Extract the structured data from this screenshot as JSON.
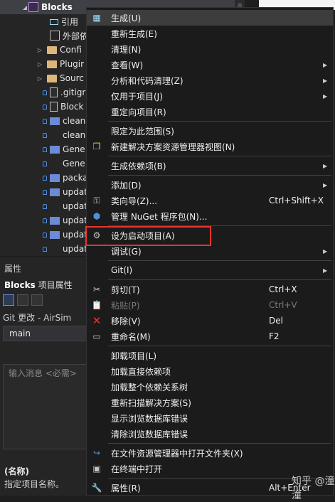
{
  "explorer": {
    "project": "Blocks",
    "items": [
      {
        "label": "引用"
      },
      {
        "label": "外部依"
      },
      {
        "label": "Confi"
      },
      {
        "label": "Plugir"
      },
      {
        "label": "Sourc"
      },
      {
        "label": ".gitigr"
      },
      {
        "label": "Block"
      },
      {
        "label": "clean"
      },
      {
        "label": "clean"
      },
      {
        "label": "Gene"
      },
      {
        "label": "Gene"
      },
      {
        "label": "packa"
      },
      {
        "label": "updat"
      },
      {
        "label": "updat"
      },
      {
        "label": "updat"
      },
      {
        "label": "updat"
      },
      {
        "label": "updat"
      }
    ]
  },
  "properties": {
    "header": "属性",
    "object_name": "Blocks",
    "object_type": "项目属性",
    "git_title": "Git 更改 - AirSim",
    "branch": "main",
    "commit_placeholder": "输入消息 <必需>",
    "name_label": "(名称)",
    "name_desc": "指定项目名称。"
  },
  "menu": {
    "items": [
      {
        "label": "生成(U)",
        "icon": "build-icon"
      },
      {
        "label": "重新生成(E)"
      },
      {
        "label": "清理(N)"
      },
      {
        "label": "查看(W)",
        "submenu": true
      },
      {
        "label": "分析和代码清理(Z)",
        "submenu": true
      },
      {
        "label": "仅用于项目(J)",
        "submenu": true
      },
      {
        "label": "重定向项目(R)"
      },
      {
        "label": "限定为此范围(S)"
      },
      {
        "label": "新建解决方案资源管理器视图(N)",
        "icon": "new-view-icon"
      },
      {
        "label": "生成依赖项(B)",
        "submenu": true
      },
      {
        "label": "添加(D)",
        "submenu": true
      },
      {
        "label": "类向导(Z)...",
        "icon": "class-wizard-icon",
        "shortcut": "Ctrl+Shift+X"
      },
      {
        "label": "管理 NuGet 程序包(N)...",
        "icon": "nuget-icon"
      },
      {
        "label": "设为启动项目(A)",
        "icon": "gear-icon"
      },
      {
        "label": "调试(G)",
        "submenu": true
      },
      {
        "label": "Git(I)",
        "submenu": true
      },
      {
        "label": "剪切(T)",
        "icon": "scissors-icon",
        "shortcut": "Ctrl+X"
      },
      {
        "label": "粘贴(P)",
        "icon": "paste-icon",
        "shortcut": "Ctrl+V",
        "disabled": true
      },
      {
        "label": "移除(V)",
        "icon": "remove-icon",
        "shortcut": "Del"
      },
      {
        "label": "重命名(M)",
        "icon": "rename-icon",
        "shortcut": "F2"
      },
      {
        "label": "卸载项目(L)"
      },
      {
        "label": "加载直接依赖项"
      },
      {
        "label": "加载整个依赖关系树"
      },
      {
        "label": "重新扫描解决方案(S)"
      },
      {
        "label": "显示浏览数据库错误"
      },
      {
        "label": "清除浏览数据库错误"
      },
      {
        "label": "在文件资源管理器中打开文件夹(X)",
        "icon": "open-folder-icon"
      },
      {
        "label": "在终端中打开",
        "icon": "terminal-icon"
      },
      {
        "label": "属性(R)",
        "icon": "wrench-icon",
        "shortcut": "Alt+Enter"
      }
    ]
  },
  "watermark": "知乎 @潼潼",
  "colors": {
    "highlight": "#e8352e",
    "menu_bg": "#1b1b1c",
    "accent": "#4e90d8"
  }
}
